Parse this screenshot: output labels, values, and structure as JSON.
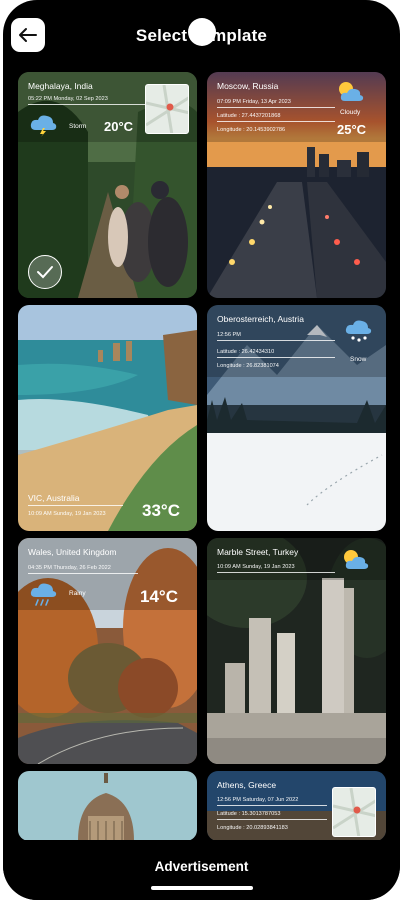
{
  "header": {
    "title": "Select Template"
  },
  "templates": [
    {
      "location": "Meghalaya, India",
      "datetime": "05:22 PM Monday, 02 Sep 2023",
      "condition": "Storm",
      "temp": "20°C"
    },
    {
      "location": "Moscow, Russia",
      "datetime": "07:09 PM Friday, 13 Apr 2023",
      "latitude": "Latitude : 27.4437201868",
      "longitude": "Longitude : 20.1453902786",
      "condition": "Cloudy",
      "temp": "25°C"
    },
    {
      "location": "VIC, Australia",
      "datetime": "10:09 AM Sunday, 19 Jan 2023",
      "temp": "33°C"
    },
    {
      "location": "Oberosterreich, Austria",
      "time": "12:56 PM",
      "latitude": "Latitude : 26.42434310",
      "longitude": "Longitude : 26.82381074",
      "condition": "Snow"
    },
    {
      "location": "Wales, United Kingdom",
      "datetime": "04:35 PM Thursday, 26 Feb 2022",
      "condition": "Rainy",
      "temp": "14°C"
    },
    {
      "location": "Marble Street, Turkey",
      "datetime": "10:09 AM Sunday, 19 Jan 2023"
    },
    {},
    {
      "location": "Athens, Greece",
      "datetime": "12:56 PM Saturday, 07 Jun 2022",
      "latitude": "Latitude : 15.3013787053",
      "longitude": "Longitude : 20.02893841183"
    }
  ],
  "footer": {
    "ad_label": "Advertisement"
  },
  "icons": {
    "back": "arrow-left-icon",
    "storm": "storm-cloud-icon",
    "cloudy": "partly-cloudy-icon",
    "snow": "snow-cloud-icon",
    "rain": "rain-cloud-icon",
    "check": "check-icon",
    "map": "map-icon"
  }
}
